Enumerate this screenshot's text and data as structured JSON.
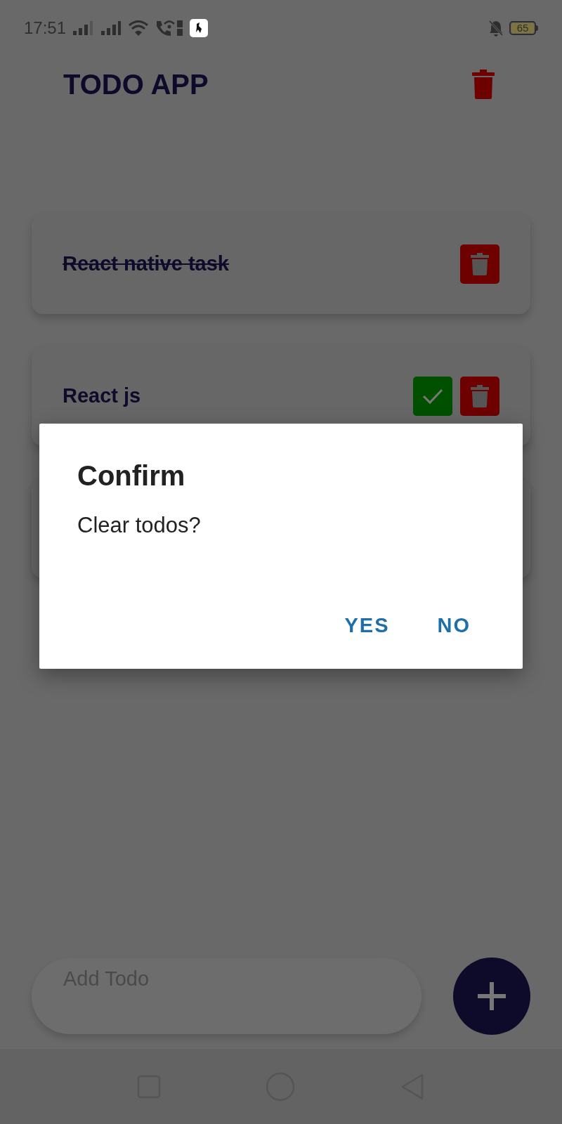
{
  "status_bar": {
    "time": "17:51",
    "battery": "65"
  },
  "app_bar": {
    "title": "TODO APP"
  },
  "todos": [
    {
      "text": "React native task",
      "done": true
    },
    {
      "text": "React js",
      "done": false
    }
  ],
  "input": {
    "placeholder": "Add Todo"
  },
  "dialog": {
    "title": "Confirm",
    "message": "Clear todos?",
    "buttons": [
      "YES",
      "NO"
    ]
  }
}
